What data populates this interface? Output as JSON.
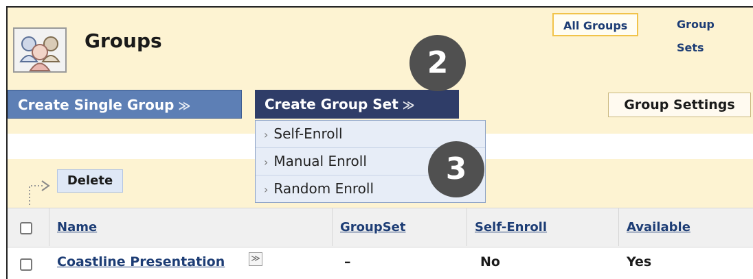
{
  "page": {
    "title": "Groups"
  },
  "view_tabs": {
    "all_groups": "All Groups",
    "group_sets": "Group Sets"
  },
  "toolbar": {
    "create_single_group": "Create Single Group",
    "create_group_set": "Create Group Set",
    "group_settings": "Group Settings"
  },
  "group_set_menu": {
    "items": [
      "Self-Enroll",
      "Manual Enroll",
      "Random Enroll"
    ]
  },
  "steps": {
    "step_2": "2",
    "step_3": "3"
  },
  "actions": {
    "delete": "Delete"
  },
  "table": {
    "headers": [
      "Name",
      "GroupSet",
      "Self-Enroll",
      "Available"
    ],
    "rows": [
      {
        "name": "Coastline Presentation",
        "groupset": "–",
        "self_enroll": "No",
        "available": "Yes"
      }
    ]
  },
  "colors": {
    "header_background": "#fdf3d2",
    "primary_button": "#5d7fb5",
    "active_menu_button": "#2f3d68",
    "link": "#1d3d75",
    "step_badge": "#505050"
  },
  "icons": {
    "page_icon": "group-people-icon",
    "dropdown_chevron": "double-chevron-down-icon",
    "menu_item_arrow": "chevron-right-icon",
    "bulk_action": "move-arrow-icon"
  }
}
